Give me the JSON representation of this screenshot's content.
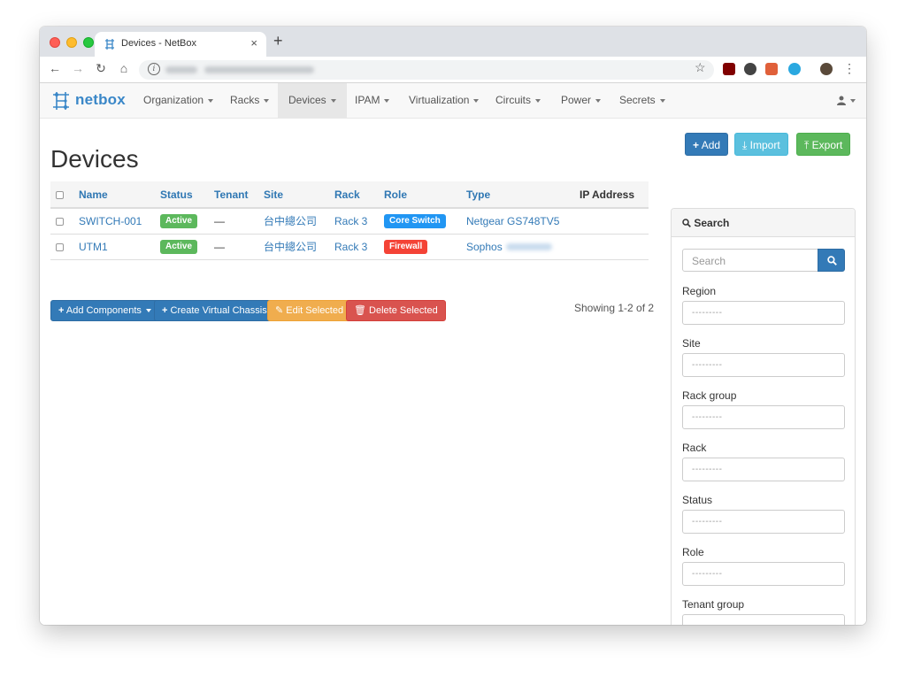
{
  "browser": {
    "tab_title": "Devices - NetBox",
    "tab_close": "×",
    "new_tab": "+",
    "back": "←",
    "forward": "→",
    "reload": "↻",
    "home": "⌂",
    "info": "i",
    "bookmark": "☆",
    "menu": "⋮"
  },
  "navbar": {
    "brand": "netbox",
    "items": [
      {
        "label": "Organization"
      },
      {
        "label": "Racks"
      },
      {
        "label": "Devices",
        "active": true
      },
      {
        "label": "IPAM"
      },
      {
        "label": "Virtualization"
      },
      {
        "label": "Circuits"
      },
      {
        "label": "Power"
      },
      {
        "label": "Secrets"
      }
    ],
    "user_icon": "user-icon"
  },
  "page": {
    "title": "Devices",
    "actions": {
      "add": "Add",
      "import": "Import",
      "export": "Export"
    }
  },
  "table": {
    "columns": [
      "Name",
      "Status",
      "Tenant",
      "Site",
      "Rack",
      "Role",
      "Type",
      "IP Address"
    ],
    "rows": [
      {
        "name": "SWITCH-001",
        "status": "Active",
        "tenant": "—",
        "site": "台中總公司",
        "rack": "Rack 3",
        "role": "Core Switch",
        "type": "Netgear GS748TV5",
        "ip": ""
      },
      {
        "name": "UTM1",
        "status": "Active",
        "tenant": "—",
        "site": "台中總公司",
        "rack": "Rack 3",
        "role": "Firewall",
        "type": "Sophos",
        "ip": ""
      }
    ],
    "showing": "Showing 1-2 of 2"
  },
  "bulk_actions": {
    "add_components": "Add Components",
    "create_virtual_chassis": "Create Virtual Chassis",
    "edit_selected": "Edit Selected",
    "delete_selected": "Delete Selected"
  },
  "search_panel": {
    "heading": "Search",
    "search_placeholder": "Search",
    "filters": [
      {
        "label": "Region",
        "value": "---------"
      },
      {
        "label": "Site",
        "value": "---------"
      },
      {
        "label": "Rack group",
        "value": "---------"
      },
      {
        "label": "Rack",
        "value": "---------"
      },
      {
        "label": "Status",
        "value": "---------"
      },
      {
        "label": "Role",
        "value": "---------"
      },
      {
        "label": "Tenant group",
        "value": "---------"
      }
    ]
  },
  "colors": {
    "primary": "#337ab7",
    "info": "#5bc0de",
    "success": "#5cb85c",
    "warning": "#f0ad4e",
    "danger": "#d9534f",
    "role_core_switch": "#2196f3",
    "role_firewall": "#f44336"
  }
}
